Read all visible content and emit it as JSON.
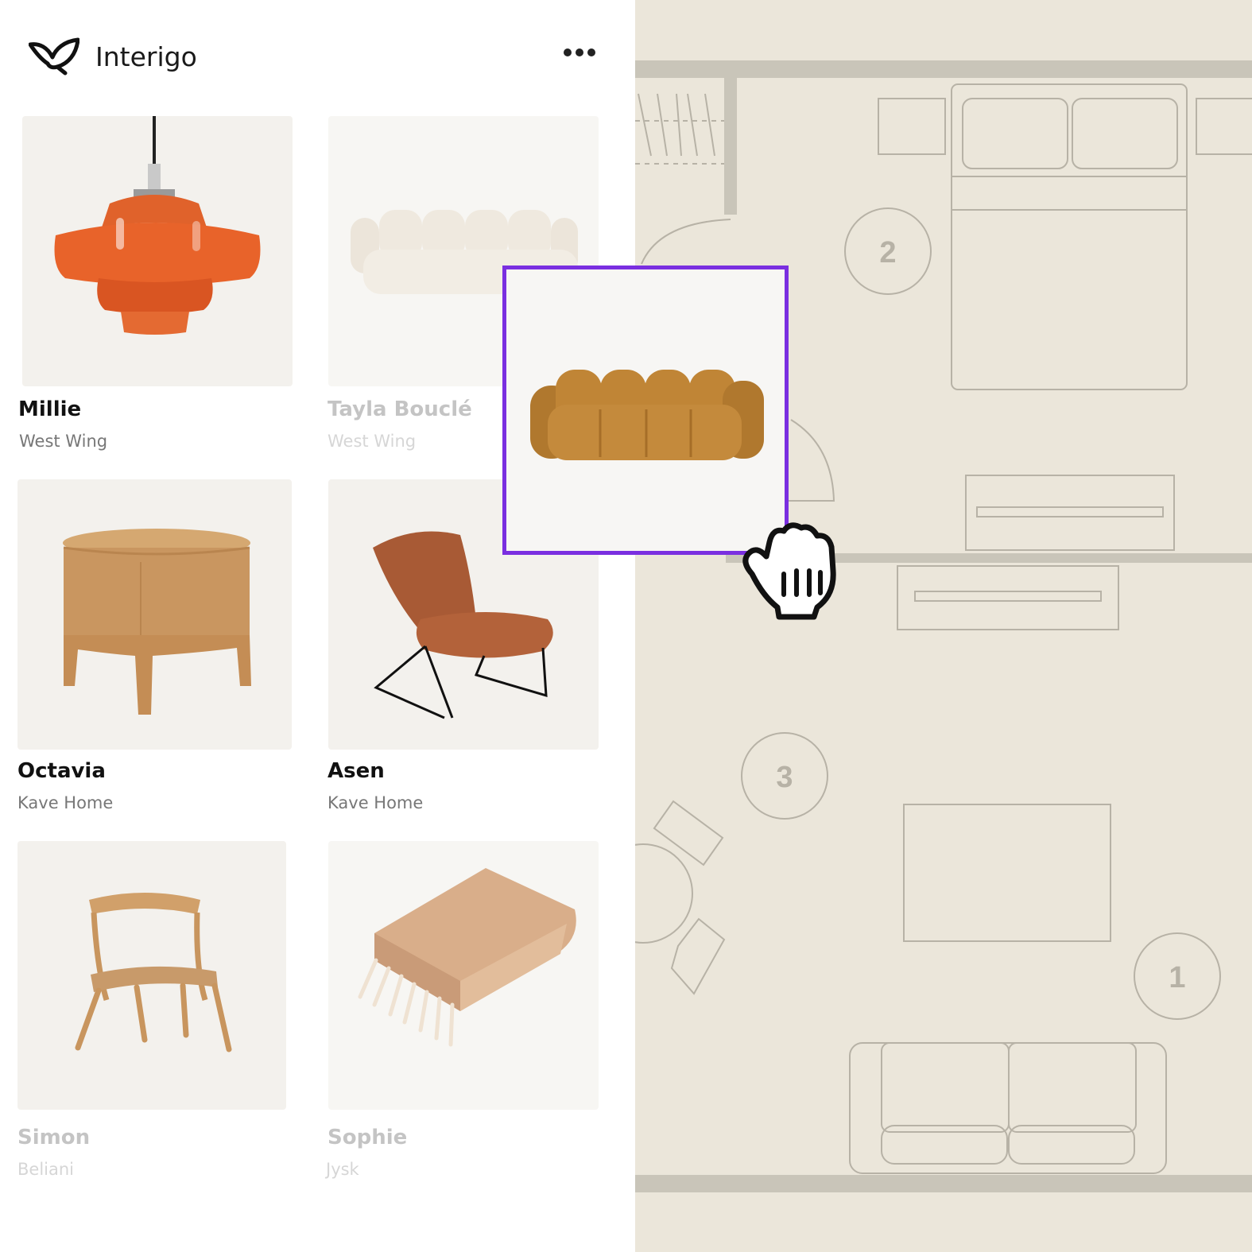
{
  "app": {
    "name": "Interigo",
    "logo_icon": "leaf-logo-icon",
    "menu_icon": "more-horizontal-icon"
  },
  "products": [
    {
      "name": "Millie",
      "store": "West Wing",
      "icon": "pendant-lamp-icon",
      "state": "normal"
    },
    {
      "name": "Tayla Bouclé",
      "store": "West Wing",
      "icon": "cream-sofa-icon",
      "state": "dragging-source"
    },
    {
      "name": "Octavia",
      "store": "Kave Home",
      "icon": "side-table-icon",
      "state": "normal"
    },
    {
      "name": "Asen",
      "store": "Kave Home",
      "icon": "lounge-chair-icon",
      "state": "normal"
    },
    {
      "name": "Simon",
      "store": "Beliani",
      "icon": "dining-chair-icon",
      "state": "faded"
    },
    {
      "name": "Sophie",
      "store": "Jysk",
      "icon": "throw-blanket-icon",
      "state": "faded"
    }
  ],
  "drag_preview": {
    "item_icon": "mustard-sofa-icon",
    "border_color": "#7a2fe0",
    "cursor_icon": "grab-hand-cursor-icon"
  },
  "floor_plan": {
    "background_color": "#ebe6da",
    "markers": [
      "2",
      "3",
      "1"
    ]
  }
}
